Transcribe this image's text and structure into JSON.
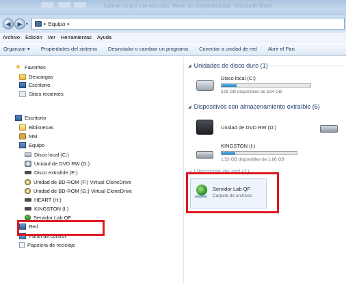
{
  "window": {
    "title": "Tutorial so put can also doc: Mode de compatibilidad - Microsoft Word"
  },
  "address": {
    "crumbs": [
      "Equipo"
    ],
    "separator": "▸"
  },
  "menu": [
    "Archivo",
    "Edición",
    "Ver",
    "Herramientas",
    "Ayuda"
  ],
  "toolbar": [
    "Organizar ▾",
    "Propiedades del sistema",
    "Desinstalar o cambiar un programa",
    "Conectar a unidad de red",
    "Abrir el Pan"
  ],
  "nav": {
    "favorites_label": "Favoritos",
    "favorites": [
      "Descargas",
      "Escritorio",
      "Sitios recientes"
    ],
    "desktop_label": "Escritorio",
    "desktop_children": [
      "Bibliotecas",
      "MM"
    ],
    "computer_label": "Equipo",
    "computer_children": [
      "Disco local (C:)",
      "Unidad de DVD RW (D:)",
      "Disco extraíble (E:)",
      "Unidad de BD-ROM (F:) Virtual CloneDrive",
      "Unidad de BD-ROM (G:) Virtual CloneDrive",
      "HEART (H:)",
      "KINGSTON (I:)",
      "Servidor Lab QF"
    ],
    "network_label": "Red",
    "control_panel_label": "Panel de control",
    "recycle_bin_label": "Papelera de reciclaje"
  },
  "content": {
    "hard_drives_header": "Unidades de disco duro (1)",
    "removable_header": "Dispositivos con almacenamiento extraíble (6)",
    "network_header": "Ubicación de red (1)",
    "drives": {
      "c_name": "Disco local (C:)",
      "c_free": "528 GB disponibles de 634 GB",
      "c_usage": 0.17,
      "dvd_name": "Unidad de DVD RW (D:)",
      "usb_name": "KINGSTON (I:)",
      "usb_free": "1,53 GB disponibles de 1,86 GB",
      "usb_usage": 0.18,
      "net_name": "Servidor Lab QF",
      "net_sub": "Carpeta de archivos"
    }
  },
  "highlight_color": "#e0171f",
  "accent_color": "#2683c8"
}
